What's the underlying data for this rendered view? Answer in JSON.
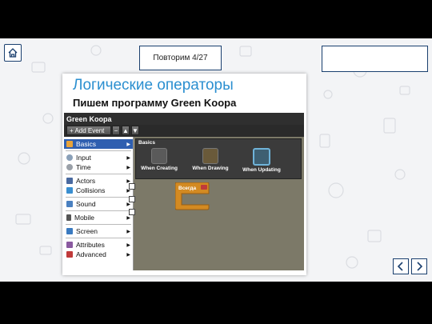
{
  "slide": {
    "counter_label": "Повторим 4/27",
    "home_icon": "home-icon",
    "prev_icon": "chevron-left-icon",
    "next_icon": "chevron-right-icon"
  },
  "screenshot": {
    "title": "Логические операторы",
    "subtitle": "Пишем программу Green Koopa"
  },
  "app": {
    "title": "Green Koopa",
    "add_event_label": "+ Add Event",
    "minus_label": "−",
    "up_label": "▲",
    "down_label": "▼",
    "sidebar": [
      {
        "label": "Basics",
        "selected": true,
        "color": "#e8a33a"
      },
      {
        "label": "Input",
        "selected": false,
        "color": "#8aa0b8"
      },
      {
        "label": "Time",
        "selected": false,
        "color": "#9aa0a8"
      },
      {
        "label": "Actors",
        "selected": false,
        "color": "#4a6aa0"
      },
      {
        "label": "Collisions",
        "selected": false,
        "color": "#3a8fd0"
      },
      {
        "label": "Sound",
        "selected": false,
        "color": "#4a80c0"
      },
      {
        "label": "Mobile",
        "selected": false,
        "color": "#555555"
      },
      {
        "label": "Screen",
        "selected": false,
        "color": "#3a7ac0"
      },
      {
        "label": "Attributes",
        "selected": false,
        "color": "#8a5aa0"
      },
      {
        "label": "Advanced",
        "selected": false,
        "color": "#c03a3a"
      }
    ],
    "basics_panel": {
      "label": "Basics",
      "items": [
        {
          "label": "When Creating",
          "selected": false
        },
        {
          "label": "When Drawing",
          "selected": false
        },
        {
          "label": "When Updating",
          "selected": true
        }
      ]
    },
    "block_label": "Всегда"
  }
}
